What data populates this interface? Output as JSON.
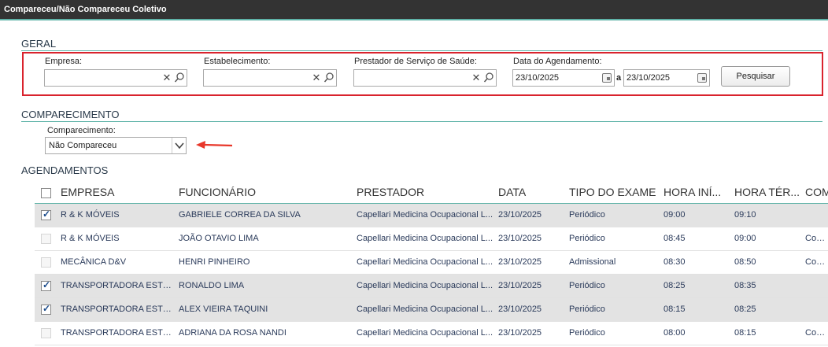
{
  "window": {
    "title": "Compareceu/Não Compareceu Coletivo"
  },
  "geral": {
    "section_title": "GERAL",
    "empresa": {
      "label": "Empresa:",
      "value": ""
    },
    "estabelecimento": {
      "label": "Estabelecimento:",
      "value": ""
    },
    "prestador": {
      "label": "Prestador de Serviço de Saúde:",
      "value": ""
    },
    "data_agendamento": {
      "label": "Data do Agendamento:",
      "from": "23/10/2025",
      "separator": "a",
      "to": "23/10/2025"
    },
    "search_button": "Pesquisar",
    "highlight_color": "#d9232d"
  },
  "comparecimento": {
    "section_title": "COMPARECIMENTO",
    "label": "Comparecimento:",
    "selected": "Não Compareceu"
  },
  "agendamentos": {
    "section_title": "AGENDAMENTOS",
    "columns": [
      "EMPRESA",
      "FUNCIONÁRIO",
      "PRESTADOR",
      "DATA",
      "TIPO DO EXAME",
      "HORA INÍ...",
      "HORA TÉR...",
      "COM"
    ],
    "rows": [
      {
        "checked": true,
        "enabled": true,
        "empresa": "R & K MÓVEIS",
        "funcionario": "GABRIELE CORREA DA SILVA",
        "prestador": "Capellari Medicina Ocupacional L...",
        "data": "23/10/2025",
        "tipo": "Periódico",
        "hora_inicio": "09:00",
        "hora_termino": "09:10",
        "comparecimento": ""
      },
      {
        "checked": false,
        "enabled": false,
        "empresa": "R & K MÓVEIS",
        "funcionario": "JOÃO OTAVIO LIMA",
        "prestador": "Capellari Medicina Ocupacional L...",
        "data": "23/10/2025",
        "tipo": "Periódico",
        "hora_inicio": "08:45",
        "hora_termino": "09:00",
        "comparecimento": "Comp"
      },
      {
        "checked": false,
        "enabled": false,
        "empresa": "MECÂNICA D&V",
        "funcionario": "HENRI PINHEIRO",
        "prestador": "Capellari Medicina Ocupacional L...",
        "data": "23/10/2025",
        "tipo": "Admissional",
        "hora_inicio": "08:30",
        "hora_termino": "08:50",
        "comparecimento": "Comp"
      },
      {
        "checked": true,
        "enabled": true,
        "empresa": "TRANSPORTADORA ESTE...",
        "funcionario": "RONALDO LIMA",
        "prestador": "Capellari Medicina Ocupacional L...",
        "data": "23/10/2025",
        "tipo": "Periódico",
        "hora_inicio": "08:25",
        "hora_termino": "08:35",
        "comparecimento": ""
      },
      {
        "checked": true,
        "enabled": true,
        "empresa": "TRANSPORTADORA ESTE...",
        "funcionario": "ALEX VIEIRA TAQUINI",
        "prestador": "Capellari Medicina Ocupacional L...",
        "data": "23/10/2025",
        "tipo": "Periódico",
        "hora_inicio": "08:15",
        "hora_termino": "08:25",
        "comparecimento": ""
      },
      {
        "checked": false,
        "enabled": false,
        "empresa": "TRANSPORTADORA ESTE...",
        "funcionario": "ADRIANA DA ROSA NANDI",
        "prestador": "Capellari Medicina Ocupacional L...",
        "data": "23/10/2025",
        "tipo": "Periódico",
        "hora_inicio": "08:00",
        "hora_termino": "08:15",
        "comparecimento": "Comp"
      }
    ]
  },
  "annotation": {
    "arrow_color": "#e8372a"
  }
}
